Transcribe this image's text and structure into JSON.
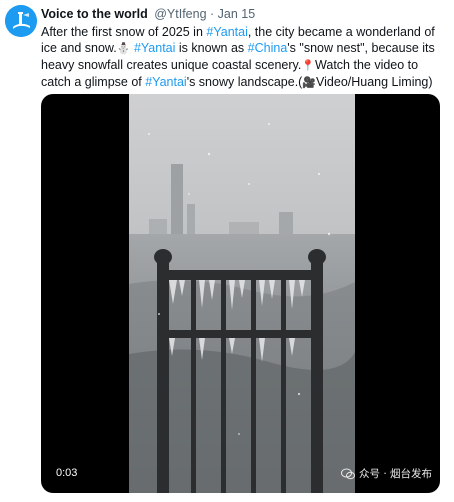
{
  "tweet": {
    "display_name": "Voice to the world",
    "handle": "@YtIfeng",
    "separator": "·",
    "date": "Jan 15",
    "text": {
      "p1": "After the first snow  of 2025 in ",
      "tag1": "#Yantai",
      "p2": ", the city became a wonderland of ice and snow.",
      "emoji_snowman": "⛄",
      "p2b": " ",
      "tag2": "#Yantai",
      "p3": " is known as ",
      "tag3": "#China",
      "p4": "'s \"snow nest\", because its heavy snowfall creates unique coastal scenery.",
      "emoji_pin": "📍",
      "p5": "Watch the video to catch a glimpse of ",
      "tag4": "#Yantai",
      "p6": "'s snowy landscape.(",
      "emoji_camera": "🎥",
      "p7": "Video/Huang Liming)"
    },
    "media": {
      "timestamp": "0:03",
      "watermark": "众号 · 烟台发布"
    }
  },
  "colors": {
    "accent": "#1d9bf0",
    "text": "#0f1419",
    "muted": "#536471"
  }
}
